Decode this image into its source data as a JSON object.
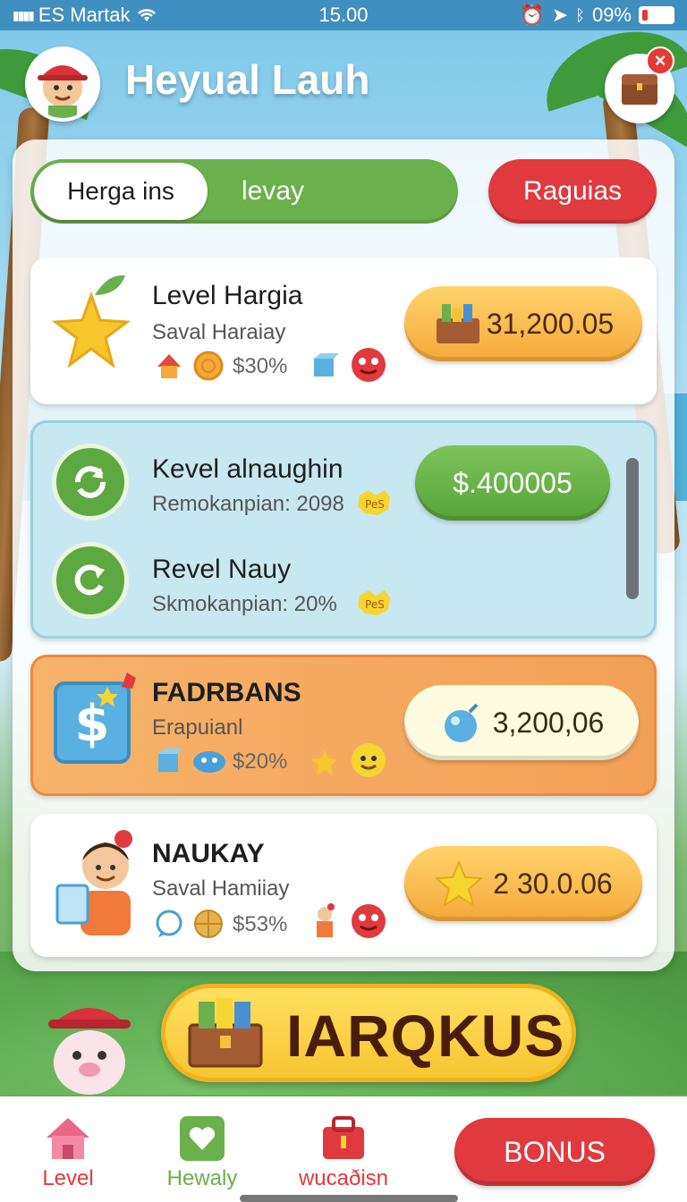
{
  "status": {
    "carrier": "ES Martak",
    "time": "15.00",
    "battery": "09%"
  },
  "header": {
    "title": "Heyual Lauh"
  },
  "tabs": {
    "active": "Herga ins",
    "inactive": "levay",
    "action": "Raguias"
  },
  "cards": [
    {
      "title": "Level Hargia",
      "subtitle": "Saval Haraiay",
      "percent": "$30%",
      "price": "31,200.05"
    },
    {
      "title": "Kevel alnaughin",
      "subtitle": "Remokanpian: 2098",
      "badge": "PeS",
      "price": "$.400005"
    },
    {
      "title": "Revel Nauy",
      "subtitle": "Skmokanpian: 20%",
      "badge": "PeS"
    },
    {
      "title": "FADRBANS",
      "subtitle": "Erapuianl",
      "percent": "$20%",
      "price": "3,200,06"
    },
    {
      "title": "NAUKAY",
      "subtitle": "Saval Hamiiay",
      "percent": "$53%",
      "price": "2 30.0.06"
    }
  ],
  "main_button": {
    "label": "IARQKUS"
  },
  "nav": {
    "items": [
      {
        "label": "Level",
        "color": "#e0393e"
      },
      {
        "label": "Hewaly",
        "color": "#6ab04c"
      },
      {
        "label": "wucaðisn",
        "color": "#e0393e"
      }
    ],
    "bonus": "BONUS"
  },
  "colors": {
    "accent_red": "#e0393e",
    "accent_green": "#6ab04c",
    "gold": "#f5a93a"
  }
}
